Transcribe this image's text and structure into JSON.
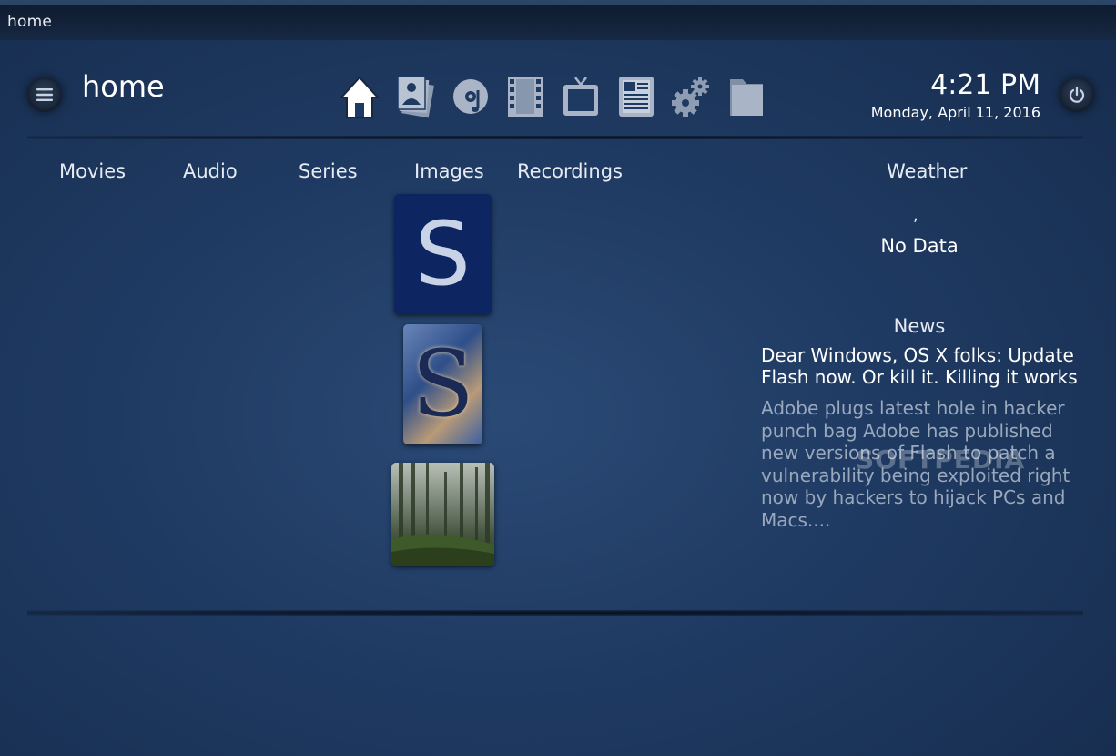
{
  "window": {
    "title": "home"
  },
  "header": {
    "page_title": "home",
    "time": "4:21 PM",
    "date": "Monday, April 11, 2016"
  },
  "nav_icons": [
    "home-icon",
    "images-icon",
    "music-disc-icon",
    "film-icon",
    "tv-icon",
    "news-icon",
    "settings-gears-icon",
    "folder-icon"
  ],
  "columns": {
    "movies": "Movies",
    "audio": "Audio",
    "series": "Series",
    "images": "Images",
    "recordings": "Recordings",
    "weather": "Weather"
  },
  "weather": {
    "location_line": ",",
    "status": "No Data"
  },
  "news": {
    "header": "News",
    "title": "Dear Windows, OS X folks: Update Flash now. Or kill it. Killing it works",
    "body": "Adobe plugs latest hole in hacker punch bag Adobe has published new versions of Flash to patch a vulnerability being exploited right now by hackers to hijack PCs and Macs...."
  },
  "images_thumbs": [
    {
      "label": "S"
    },
    {
      "label": "S"
    },
    {
      "label": ""
    }
  ],
  "watermark": "SOFTPEDIA",
  "colors": {
    "background": "#1f3a62",
    "titlebar": "#142339",
    "muted_text": "#9aa8bb"
  }
}
